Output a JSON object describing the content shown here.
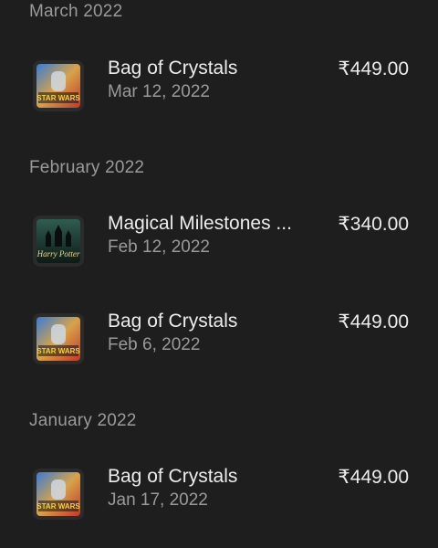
{
  "sections": [
    {
      "header": "March 2022",
      "items": [
        {
          "title": "Bag of Crystals",
          "date": "Mar 12, 2022",
          "price": "₹449.00",
          "icon": "star-wars-game-icon",
          "icon_text": "STAR WARS"
        }
      ]
    },
    {
      "header": "February 2022",
      "items": [
        {
          "title": "Magical Milestones ...",
          "date": "Feb 12, 2022",
          "price": "₹340.00",
          "icon": "harry-potter-game-icon",
          "icon_text": "Harry Potter"
        },
        {
          "title": "Bag of Crystals",
          "date": "Feb 6, 2022",
          "price": "₹449.00",
          "icon": "star-wars-game-icon",
          "icon_text": "STAR WARS"
        }
      ]
    },
    {
      "header": "January 2022",
      "items": [
        {
          "title": "Bag of Crystals",
          "date": "Jan 17, 2022",
          "price": "₹449.00",
          "icon": "star-wars-game-icon",
          "icon_text": "STAR WARS"
        }
      ]
    }
  ]
}
